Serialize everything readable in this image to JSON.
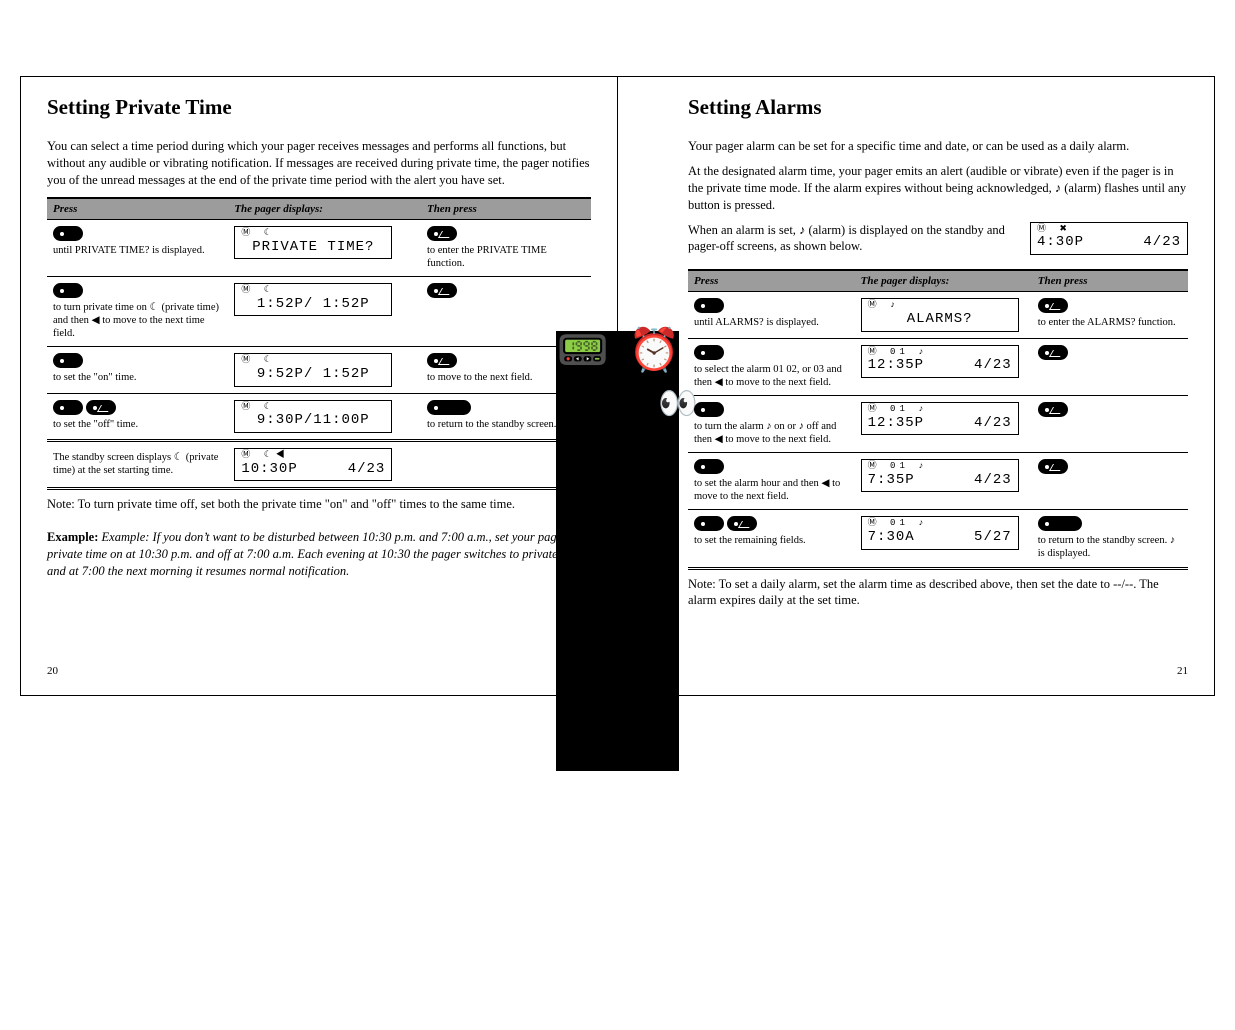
{
  "page_left": {
    "number": "20",
    "title": "Setting Private Time",
    "lead": "You can select a time period during which your pager receives messages and performs all functions, but without any audible or vibrating notification. If messages are received during private time, the pager notifies you of the unread messages at the end of the private time period with the alert you have set.",
    "headers": [
      "Press",
      "The pager displays:",
      "Then press"
    ],
    "rows": [
      {
        "press_btn1": "menu",
        "press_txt": "until PRIVATE TIME? is displayed.",
        "lcd_icons": "Ⓜ          ☾",
        "lcd_main": "PRIVATE TIME?",
        "next_btn": "read",
        "next_txt": "to enter the PRIVATE TIME function."
      },
      {
        "press_btn1": "menu",
        "press_txt": "to turn private time on ☾ (private time) and then ◀ to move to the next time field.",
        "lcd_icons": "Ⓜ            ☾",
        "lcd_main": "1:52P/ 1:52P",
        "next_btn": "read",
        "next_txt": ""
      },
      {
        "press_btn1": "menu",
        "press_txt": "to set the \"on\" time.",
        "lcd_icons": "Ⓜ          ☾",
        "lcd_main": "9:52P/ 1:52P",
        "next_btn": "read",
        "next_txt": "to move to the next field."
      },
      {
        "press_btn1": "menu",
        "press_btn2": "read",
        "press_txt": "to set the \"off\" time.",
        "lcd_icons": "Ⓜ          ☾",
        "lcd_main": "9:30P/11:00P",
        "next_btn": "big",
        "next_txt": "to return to the standby screen."
      }
    ],
    "standby": {
      "txt": "The standby screen displays ☾ (private time) at the set starting time.",
      "lcd_icons": "Ⓜ        ☾◀",
      "lcd_main_left": "10:30P",
      "lcd_main_right": "4/23"
    },
    "note": "Note: To turn private time off, set both the private time \"on\" and \"off\" times to the same time.",
    "example": "Example: If you don’t want to be disturbed between 10:30 p.m. and 7:00 a.m., set your pager's private time on at 10:30 p.m. and off at 7:00 a.m. Each evening at 10:30 the pager switches to private time and at 7:00 the next morning it resumes normal notification."
  },
  "page_right": {
    "number": "21",
    "title": "Setting Alarms",
    "lead1": "Your pager alarm can be set for a specific time and date, or can be used as a daily alarm.",
    "lead2_a": "At the designated alarm time, your pager emits an alert (audible or vibrate) even if the pager is in the private time mode. If the alarm expires without being acknowledged, ",
    "lead2_bell": "♪",
    "lead2_b": " (alarm) flashes until any button is pressed.",
    "lead3_a": "When an alarm is set, ",
    "lead3_bell": "♪",
    "lead3_b": " (alarm) is displayed on the standby and pager-off screens, as shown below.",
    "lcd_top_icons": "Ⓜ                ✖",
    "lcd_top_left": "4:30P",
    "lcd_top_right": "4/23",
    "headers": [
      "Press",
      "The pager displays:",
      "Then press"
    ],
    "rows": [
      {
        "press_btn1": "menu",
        "press_txt": "until ALARMS? is displayed.",
        "lcd_icons": "Ⓜ               ♪",
        "lcd_main": "ALARMS?",
        "next_btn": "read",
        "next_txt": "to enter the ALARMS? function."
      },
      {
        "press_btn1": "menu",
        "press_txt": "to select the alarm 01 02, or 03 and then ◀ to move to the next field.",
        "lcd_icons": "Ⓜ     01         ♪",
        "lcd_left": "12:35P",
        "lcd_right": "4/23",
        "next_btn": "read",
        "next_txt": ""
      },
      {
        "press_btn1": "menu",
        "press_txt": "to turn the alarm ♪ on or ♪ off and then ◀ to move to the next field.",
        "lcd_icons": "Ⓜ     01         ♪",
        "lcd_left": "12:35P",
        "lcd_right": "4/23",
        "next_btn": "read",
        "next_txt": ""
      },
      {
        "press_btn1": "menu",
        "press_txt": "to set the alarm hour and then ◀ to move to the next field.",
        "lcd_icons": "Ⓜ     01         ♪",
        "lcd_left": "7:35P",
        "lcd_right": "4/23",
        "next_btn": "read",
        "next_txt": ""
      },
      {
        "press_btn1": "menu",
        "press_btn2": "read",
        "press_txt": "to set the remaining fields.",
        "lcd_icons": "Ⓜ     01         ♪",
        "lcd_left": "7:30A",
        "lcd_right": "5/27",
        "next_btn": "big",
        "next_txt": "to return to the standby screen.   ♪ is displayed."
      }
    ],
    "footnote": "Note: To set a daily alarm, set the alarm time as described above, then set the date to --/--. The alarm expires daily at the set time."
  }
}
